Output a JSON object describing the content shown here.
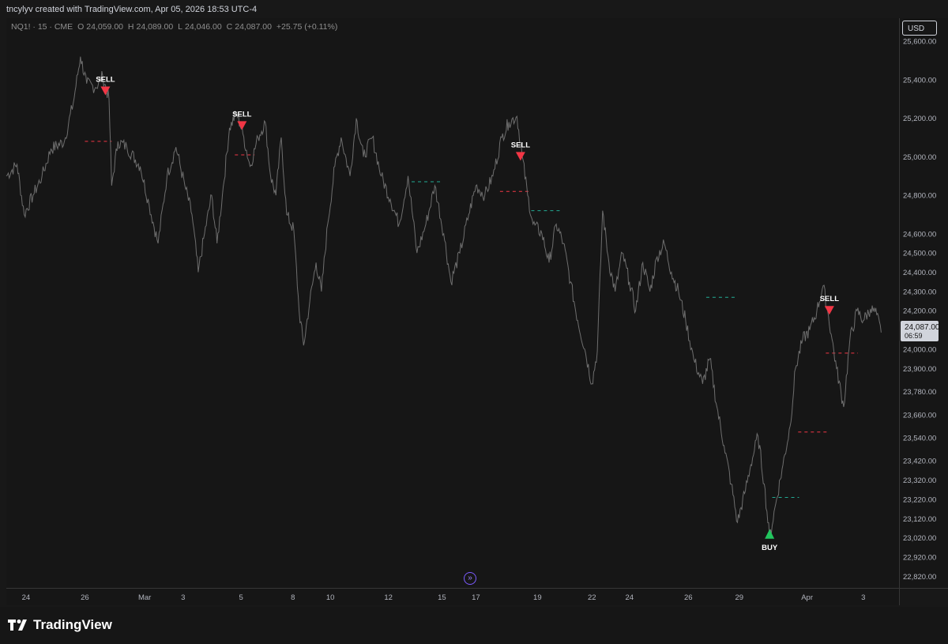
{
  "header": {
    "credit": "tncylyv created with TradingView.com, Apr 05, 2026 18:53 UTC-4"
  },
  "legend": {
    "symbol": "NQ1! · 15 · CME",
    "open_label": "O",
    "open": "24,059.00",
    "high_label": "H",
    "high": "24,089.00",
    "low_label": "L",
    "low": "24,046.00",
    "close_label": "C",
    "close": "24,087.00",
    "change": "+25.75 (+0.11%)"
  },
  "price_scale": {
    "currency": "USD",
    "last_price": "24,087.00",
    "countdown": "06:59"
  },
  "brand": {
    "name": "TradingView"
  },
  "colors": {
    "background": "#181818",
    "price_line": "#6e6e6e",
    "sell": "#f23645",
    "buy": "#22c55e",
    "sell_level": "#f23645",
    "buy_level": "#22ab94",
    "label_bg": "#d1d4dc"
  },
  "chart_data": {
    "type": "line",
    "title": "",
    "ylim": [
      22760,
      25720
    ],
    "y_ticks": [
      25600,
      25400,
      25200,
      25000,
      24800,
      24600,
      24500,
      24400,
      24300,
      24200,
      24100,
      24000,
      23900,
      23780,
      23660,
      23540,
      23420,
      23320,
      23220,
      23120,
      23020,
      22920,
      22820
    ],
    "y_tick_labels": [
      "25,600.00",
      "25,400.00",
      "25,200.00",
      "25,000.00",
      "24,800.00",
      "24,600.00",
      "24,500.00",
      "24,400.00",
      "24,300.00",
      "24,200.00",
      "24,100.00",
      "24,000.00",
      "23,900.00",
      "23,780.00",
      "23,660.00",
      "23,540.00",
      "23,420.00",
      "23,320.00",
      "23,220.00",
      "23,120.00",
      "23,020.00",
      "22,920.00",
      "22,820.00"
    ],
    "x_range": [
      0,
      100
    ],
    "x_ticks": [
      {
        "x": 2.2,
        "label": "24"
      },
      {
        "x": 8.8,
        "label": "26"
      },
      {
        "x": 15.5,
        "label": "Mar"
      },
      {
        "x": 19.8,
        "label": "3"
      },
      {
        "x": 26.3,
        "label": "5"
      },
      {
        "x": 32.1,
        "label": "8"
      },
      {
        "x": 36.3,
        "label": "10"
      },
      {
        "x": 42.8,
        "label": "12"
      },
      {
        "x": 48.8,
        "label": "15"
      },
      {
        "x": 52.6,
        "label": "17"
      },
      {
        "x": 59.5,
        "label": "19"
      },
      {
        "x": 65.6,
        "label": "22"
      },
      {
        "x": 69.8,
        "label": "24"
      },
      {
        "x": 76.4,
        "label": "26"
      },
      {
        "x": 82.1,
        "label": "29"
      },
      {
        "x": 89.7,
        "label": "Apr"
      },
      {
        "x": 96.0,
        "label": "3"
      }
    ],
    "series": [
      {
        "values": [
          [
            0,
            24900
          ],
          [
            1.2,
            24960
          ],
          [
            2.0,
            24700
          ],
          [
            3.0,
            24800
          ],
          [
            4.0,
            24900
          ],
          [
            5.0,
            25040
          ],
          [
            6.5,
            25080
          ],
          [
            7.5,
            25280
          ],
          [
            8.3,
            25520
          ],
          [
            9.0,
            25380
          ],
          [
            10.0,
            25360
          ],
          [
            10.8,
            25420
          ],
          [
            11.5,
            25300
          ],
          [
            11.8,
            24850
          ],
          [
            12.5,
            25080
          ],
          [
            13.5,
            25050
          ],
          [
            15.0,
            24950
          ],
          [
            16.0,
            24750
          ],
          [
            17.0,
            24550
          ],
          [
            18.0,
            24900
          ],
          [
            19.0,
            25050
          ],
          [
            20.0,
            24850
          ],
          [
            20.8,
            24700
          ],
          [
            21.5,
            24400
          ],
          [
            22.2,
            24600
          ],
          [
            23.0,
            24800
          ],
          [
            23.6,
            24550
          ],
          [
            24.2,
            24800
          ],
          [
            25.0,
            25150
          ],
          [
            25.8,
            25230
          ],
          [
            26.5,
            25120
          ],
          [
            27.3,
            24950
          ],
          [
            28.2,
            25100
          ],
          [
            29.0,
            25180
          ],
          [
            29.6,
            24900
          ],
          [
            30.2,
            24800
          ],
          [
            30.8,
            25100
          ],
          [
            31.4,
            24700
          ],
          [
            32.2,
            24620
          ],
          [
            32.8,
            24200
          ],
          [
            33.3,
            24020
          ],
          [
            34.0,
            24250
          ],
          [
            34.7,
            24450
          ],
          [
            35.3,
            24300
          ],
          [
            36.0,
            24650
          ],
          [
            36.8,
            24950
          ],
          [
            37.5,
            25100
          ],
          [
            38.5,
            24900
          ],
          [
            39.2,
            25200
          ],
          [
            40.0,
            25000
          ],
          [
            41.0,
            25100
          ],
          [
            42.0,
            24900
          ],
          [
            43.0,
            24780
          ],
          [
            44.0,
            24650
          ],
          [
            45.0,
            24900
          ],
          [
            46.0,
            24500
          ],
          [
            47.0,
            24650
          ],
          [
            48.0,
            24850
          ],
          [
            49.0,
            24600
          ],
          [
            49.8,
            24350
          ],
          [
            50.8,
            24500
          ],
          [
            51.8,
            24700
          ],
          [
            52.6,
            24850
          ],
          [
            53.6,
            24800
          ],
          [
            54.5,
            24900
          ],
          [
            55.5,
            25100
          ],
          [
            56.3,
            25180
          ],
          [
            57.2,
            25210
          ],
          [
            57.8,
            25000
          ],
          [
            58.4,
            24800
          ],
          [
            59.0,
            24650
          ],
          [
            60.0,
            24600
          ],
          [
            60.8,
            24450
          ],
          [
            61.6,
            24650
          ],
          [
            62.4,
            24550
          ],
          [
            63.2,
            24350
          ],
          [
            64.0,
            24150
          ],
          [
            64.8,
            24000
          ],
          [
            65.6,
            23820
          ],
          [
            66.2,
            23990
          ],
          [
            66.8,
            24720
          ],
          [
            67.5,
            24450
          ],
          [
            68.2,
            24300
          ],
          [
            69.0,
            24500
          ],
          [
            69.8,
            24350
          ],
          [
            70.5,
            24200
          ],
          [
            71.3,
            24450
          ],
          [
            72.1,
            24300
          ],
          [
            72.9,
            24480
          ],
          [
            73.7,
            24550
          ],
          [
            74.5,
            24400
          ],
          [
            75.3,
            24300
          ],
          [
            76.1,
            24150
          ],
          [
            77.0,
            23950
          ],
          [
            78.0,
            23820
          ],
          [
            78.8,
            23950
          ],
          [
            79.6,
            23700
          ],
          [
            80.4,
            23500
          ],
          [
            81.2,
            23300
          ],
          [
            81.9,
            23100
          ],
          [
            82.7,
            23250
          ],
          [
            83.4,
            23400
          ],
          [
            84.2,
            23550
          ],
          [
            84.9,
            23300
          ],
          [
            85.5,
            23020
          ],
          [
            86.2,
            23200
          ],
          [
            87.0,
            23400
          ],
          [
            87.8,
            23600
          ],
          [
            88.4,
            23900
          ],
          [
            89.2,
            24050
          ],
          [
            90.0,
            24100
          ],
          [
            90.8,
            24200
          ],
          [
            91.5,
            24330
          ],
          [
            92.0,
            24200
          ],
          [
            92.5,
            24050
          ],
          [
            93.0,
            23900
          ],
          [
            93.8,
            23700
          ],
          [
            94.5,
            24050
          ],
          [
            95.3,
            24200
          ],
          [
            96.0,
            24150
          ],
          [
            96.8,
            24210
          ],
          [
            97.5,
            24180
          ],
          [
            98.0,
            24087
          ]
        ]
      }
    ],
    "signals": [
      {
        "type": "SELL",
        "x": 11.1,
        "y": 25340,
        "label": "SELL"
      },
      {
        "type": "SELL",
        "x": 26.4,
        "y": 25160,
        "label": "SELL"
      },
      {
        "type": "SELL",
        "x": 57.6,
        "y": 25000,
        "label": "SELL"
      },
      {
        "type": "BUY",
        "x": 85.5,
        "y": 23040,
        "label": "BUY"
      },
      {
        "type": "SELL",
        "x": 92.2,
        "y": 24200,
        "label": "SELL"
      }
    ],
    "levels": [
      {
        "type": "sell",
        "x0": 8.8,
        "x1": 11.8,
        "y": 25080
      },
      {
        "type": "sell",
        "x0": 25.6,
        "x1": 27.8,
        "y": 25010
      },
      {
        "type": "buy",
        "x0": 45.4,
        "x1": 48.6,
        "y": 24870
      },
      {
        "type": "sell",
        "x0": 55.3,
        "x1": 58.6,
        "y": 24820
      },
      {
        "type": "buy",
        "x0": 58.8,
        "x1": 62.3,
        "y": 24720
      },
      {
        "type": "buy",
        "x0": 78.4,
        "x1": 81.8,
        "y": 24270
      },
      {
        "type": "buy",
        "x0": 85.8,
        "x1": 88.8,
        "y": 23230
      },
      {
        "type": "sell",
        "x0": 88.7,
        "x1": 92.0,
        "y": 23570
      },
      {
        "type": "sell",
        "x0": 91.8,
        "x1": 95.4,
        "y": 23980
      }
    ]
  }
}
